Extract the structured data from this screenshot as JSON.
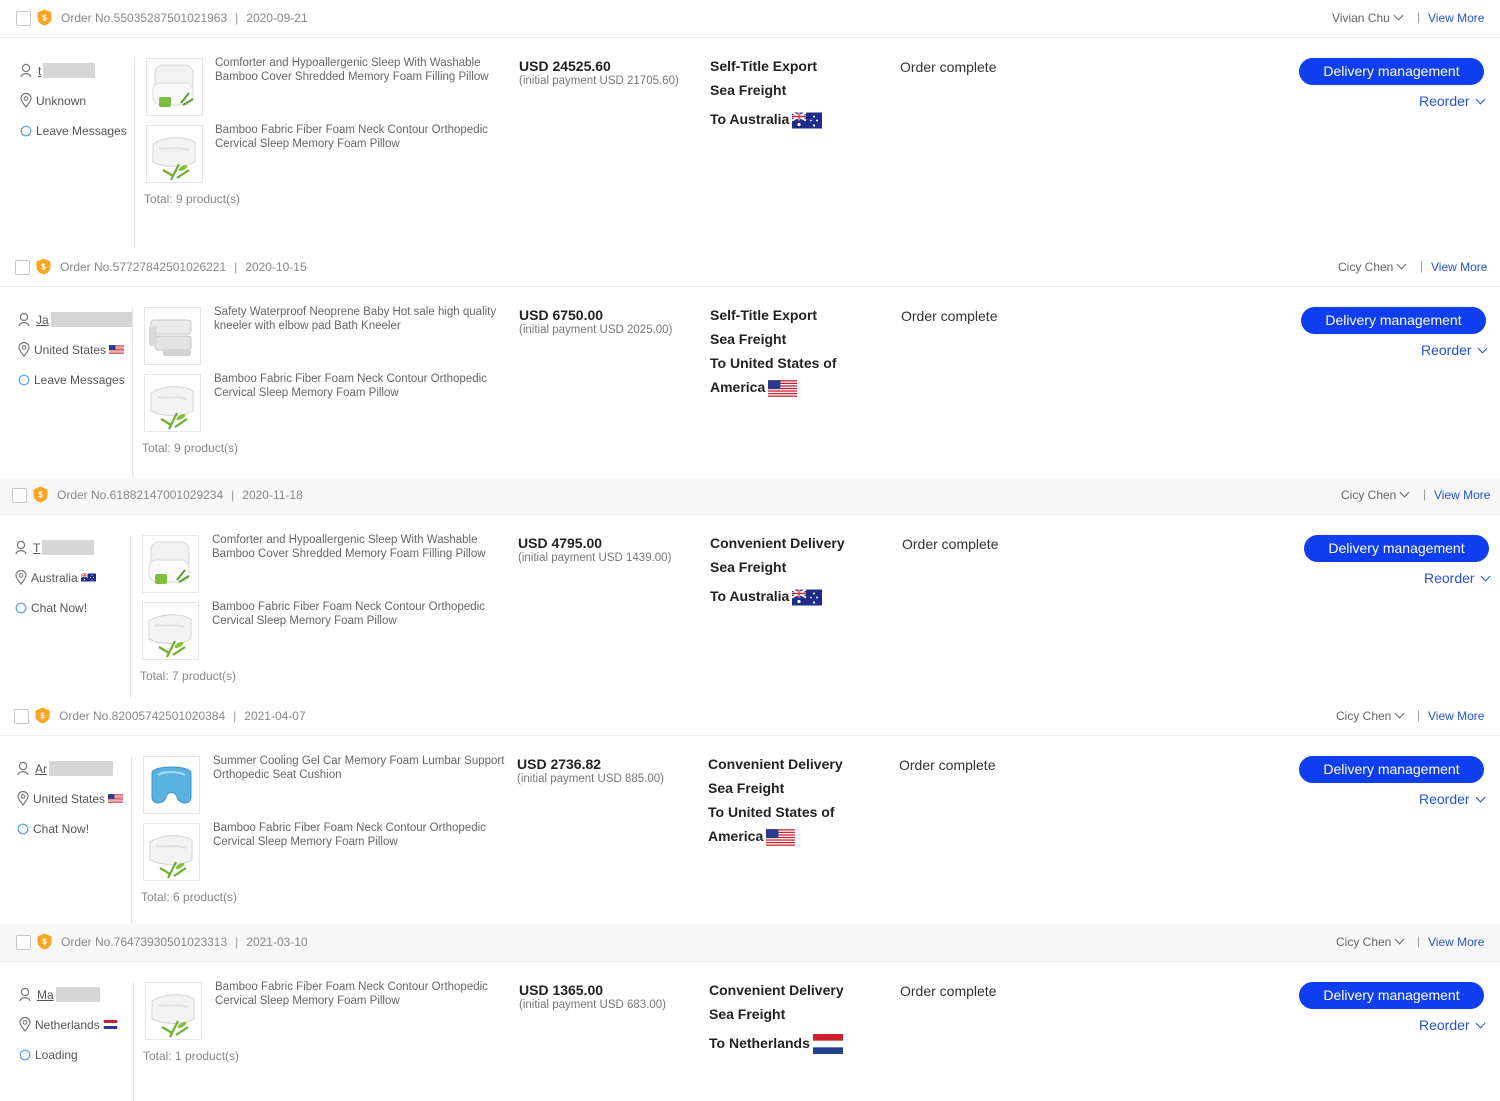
{
  "orders": [
    {
      "order_label": "Order No.550352875010219​63",
      "date": "2020-09-21",
      "owner": "Vivian Chu",
      "view_more": "View More",
      "buyer_name": "t",
      "location": "Unknown",
      "contact": "Leave Messages",
      "products": [
        {
          "title": "Comforter and Hypoallergenic Sleep With Washable Bamboo Cover Shredded Memory Foam Filling Pillow",
          "thumb": "pillow-white-icon"
        },
        {
          "title": "Bamboo Fabric Fiber Foam Neck Contour Orthopedic Cervical Sleep Memory Foam Pillow",
          "thumb": "pillow-bamboo-icon"
        }
      ],
      "total": "Total:  9 product(s)",
      "price": "USD 24525.60",
      "initial_payment": "(initial payment USD 21705.60)",
      "shipping": [
        "Self-Title Export",
        "Sea Freight"
      ],
      "destination": [
        "To Australia"
      ],
      "destination_flag": "australia",
      "status": "Order complete",
      "delivery_button": "Delivery management",
      "reorder": "Reorder"
    },
    {
      "order_label": "Order No.577278425010262​21",
      "date": "2020-10-15",
      "owner": "Cicy Chen",
      "view_more": "View More",
      "buyer_name": "Ja",
      "location": "United States",
      "location_flag": "usa",
      "contact": "Leave Messages",
      "products": [
        {
          "title": "Safety Waterproof Neoprene Baby Hot sale high quality kneeler with elbow pad Bath Kneeler",
          "thumb": "kneeler-icon"
        },
        {
          "title": "Bamboo Fabric Fiber Foam Neck Contour Orthopedic Cervical Sleep Memory Foam Pillow",
          "thumb": "pillow-bamboo-icon"
        }
      ],
      "total": "Total:  9 product(s)",
      "price": "USD 6750.00",
      "initial_payment": "(initial payment USD 2025.00)",
      "shipping": [
        "Self-Title Export",
        "Sea Freight"
      ],
      "destination": [
        "To United States of",
        "America"
      ],
      "destination_flag": "usa",
      "status": "Order complete",
      "delivery_button": "Delivery management",
      "reorder": "Reorder"
    },
    {
      "order_label": "Order No.618821470010292​34",
      "date": "2020-11-18",
      "owner": "Cicy Chen",
      "view_more": "View More",
      "buyer_name": "T",
      "location": "Australia",
      "location_flag": "australia",
      "contact": "Chat Now!",
      "products": [
        {
          "title": "Comforter and Hypoallergenic Sleep With Washable Bamboo Cover Shredded Memory Foam Filling Pillow",
          "thumb": "pillow-white-icon"
        },
        {
          "title": "Bamboo Fabric Fiber Foam Neck Contour Orthopedic Cervical Sleep Memory Foam Pillow",
          "thumb": "pillow-bamboo-icon"
        }
      ],
      "total": "Total:  7 product(s)",
      "price": "USD 4795.00",
      "initial_payment": "(initial payment USD 1439.00)",
      "shipping": [
        "Convenient Delivery",
        "Sea Freight"
      ],
      "destination": [
        "To Australia"
      ],
      "destination_flag": "australia",
      "status": "Order complete",
      "delivery_button": "Delivery management",
      "reorder": "Reorder"
    },
    {
      "order_label": "Order No.820057425010203​84",
      "date": "2021-04-07",
      "owner": "Cicy Chen",
      "view_more": "View More",
      "buyer_name": "Ar",
      "location": "United States",
      "location_flag": "usa",
      "contact": "Chat Now!",
      "products": [
        {
          "title": "Summer Cooling Gel Car Memory Foam Lumbar Support Orthopedic Seat Cushion",
          "thumb": "gel-cushion-icon"
        },
        {
          "title": "Bamboo Fabric Fiber Foam Neck Contour Orthopedic Cervical Sleep Memory Foam Pillow",
          "thumb": "pillow-bamboo-icon"
        }
      ],
      "total": "Total:  6 product(s)",
      "price": "USD 2736.82",
      "initial_payment": "(initial payment USD 885.00)",
      "shipping": [
        "Convenient Delivery",
        "Sea Freight"
      ],
      "destination": [
        "To United States of",
        "America"
      ],
      "destination_flag": "usa",
      "status": "Order complete",
      "delivery_button": "Delivery management",
      "reorder": "Reorder"
    },
    {
      "order_label": "Order No.764739305010233​13",
      "date": "2021-03-10",
      "owner": "Cicy Chen",
      "view_more": "View More",
      "buyer_name": "Ma",
      "location": "Netherlands",
      "location_flag": "netherlands",
      "contact": "Loading",
      "products": [
        {
          "title": "Bamboo Fabric Fiber Foam Neck Contour Orthopedic Cervical Sleep Memory Foam Pillow",
          "thumb": "pillow-bamboo-icon"
        }
      ],
      "total": "Total:  1 product(s)",
      "price": "USD 1365.00",
      "initial_payment": "(initial payment USD 683.00)",
      "shipping": [
        "Convenient Delivery",
        "Sea Freight"
      ],
      "destination": [
        "To Netherlands"
      ],
      "destination_flag": "netherlands",
      "status": "Order complete",
      "delivery_button": "Delivery management",
      "reorder": "Reorder"
    }
  ],
  "colors": {
    "primary_button": "#0f3df0",
    "link": "#2453d6",
    "badge": "#f5a623"
  }
}
